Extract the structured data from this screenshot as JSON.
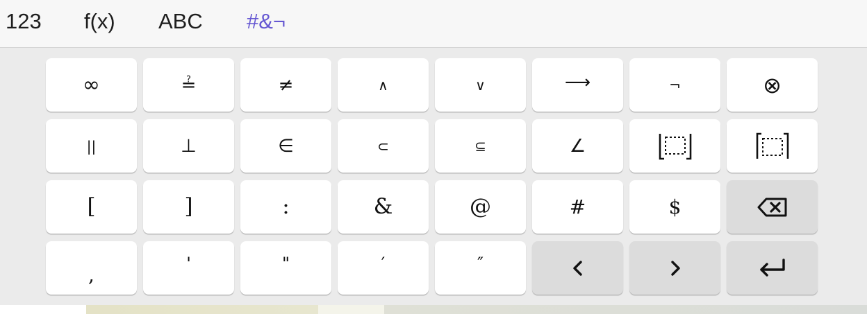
{
  "tabs": [
    {
      "label": "123",
      "active": false
    },
    {
      "label": "f(x)",
      "active": false
    },
    {
      "label": "ABC",
      "active": false
    },
    {
      "label": "#&¬",
      "active": true
    }
  ],
  "colors": {
    "active_tab": "#6557d2",
    "key_bg": "#ffffff",
    "action_key_bg": "#dcdcdc",
    "keyboard_bg": "#ebebeb"
  },
  "keys": {
    "row1": [
      "∞",
      "≟",
      "≠",
      "∧",
      "∨",
      "⟶",
      "¬",
      "⊗"
    ],
    "row2": [
      "||",
      "⊥",
      "∈",
      "⊂",
      "⊆",
      "∠"
    ],
    "row3": [
      "[",
      "]",
      ":",
      "&",
      "@",
      "#",
      "$"
    ],
    "row4": [
      ",",
      "'",
      "\"",
      "′",
      "″"
    ]
  },
  "icons": {
    "floor_bracket": "floor-bracket-icon",
    "ceil_bracket": "ceil-bracket-icon",
    "backspace": "backspace-icon",
    "left_arrow": "chevron-left-icon",
    "right_arrow": "chevron-right-icon",
    "enter": "enter-icon"
  }
}
